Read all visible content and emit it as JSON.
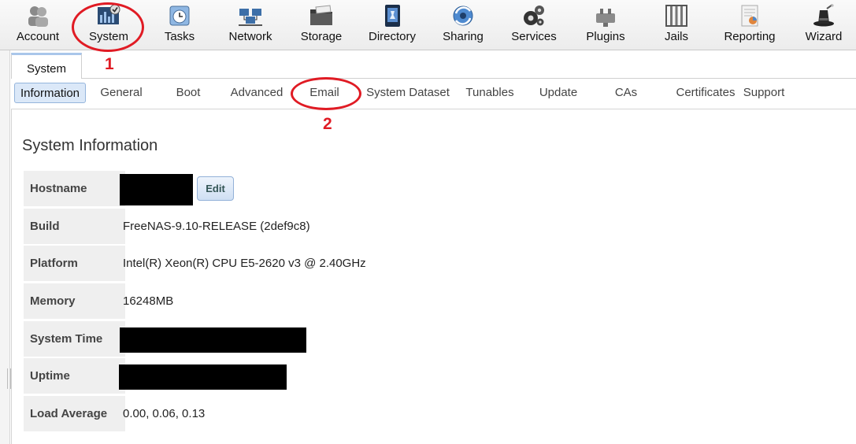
{
  "toolbar": {
    "items": [
      {
        "label": "Account",
        "icon": "users-icon"
      },
      {
        "label": "System",
        "icon": "system-monitor-icon"
      },
      {
        "label": "Tasks",
        "icon": "calendar-clock-icon"
      },
      {
        "label": "Network",
        "icon": "network-icon"
      },
      {
        "label": "Storage",
        "icon": "folder-icon"
      },
      {
        "label": "Directory",
        "icon": "directory-book-icon"
      },
      {
        "label": "Sharing",
        "icon": "sharing-globe-icon"
      },
      {
        "label": "Services",
        "icon": "gears-icon"
      },
      {
        "label": "Plugins",
        "icon": "plugin-icon"
      },
      {
        "label": "Jails",
        "icon": "jail-bars-icon"
      },
      {
        "label": "Reporting",
        "icon": "report-chart-icon"
      },
      {
        "label": "Wizard",
        "icon": "wizard-hat-icon"
      }
    ]
  },
  "outer_tab": {
    "label": "System"
  },
  "subtabs": [
    {
      "label": "Information",
      "active": true
    },
    {
      "label": "General"
    },
    {
      "label": "Boot"
    },
    {
      "label": "Advanced"
    },
    {
      "label": "Email"
    },
    {
      "label": "System Dataset"
    },
    {
      "label": "Tunables"
    },
    {
      "label": "Update"
    },
    {
      "label": "CAs"
    },
    {
      "label": "Certificates"
    },
    {
      "label": "Support"
    }
  ],
  "section": {
    "title": "System Information"
  },
  "info": {
    "hostname": {
      "label": "Hostname",
      "edit_label": "Edit"
    },
    "build": {
      "label": "Build",
      "value": "FreeNAS-9.10-RELEASE (2def9c8)"
    },
    "platform": {
      "label": "Platform",
      "value": "Intel(R) Xeon(R) CPU E5-2620 v3 @ 2.40GHz"
    },
    "memory": {
      "label": "Memory",
      "value": "16248MB"
    },
    "system_time": {
      "label": "System Time"
    },
    "uptime": {
      "label": "Uptime"
    },
    "load_average": {
      "label": "Load Average",
      "value": "0.00, 0.06, 0.13"
    }
  },
  "annotations": {
    "step1": "1",
    "step2": "2"
  },
  "colors": {
    "annotation": "#e01b24",
    "active_tab": "#dbe8f8",
    "redaction": "#000000"
  }
}
